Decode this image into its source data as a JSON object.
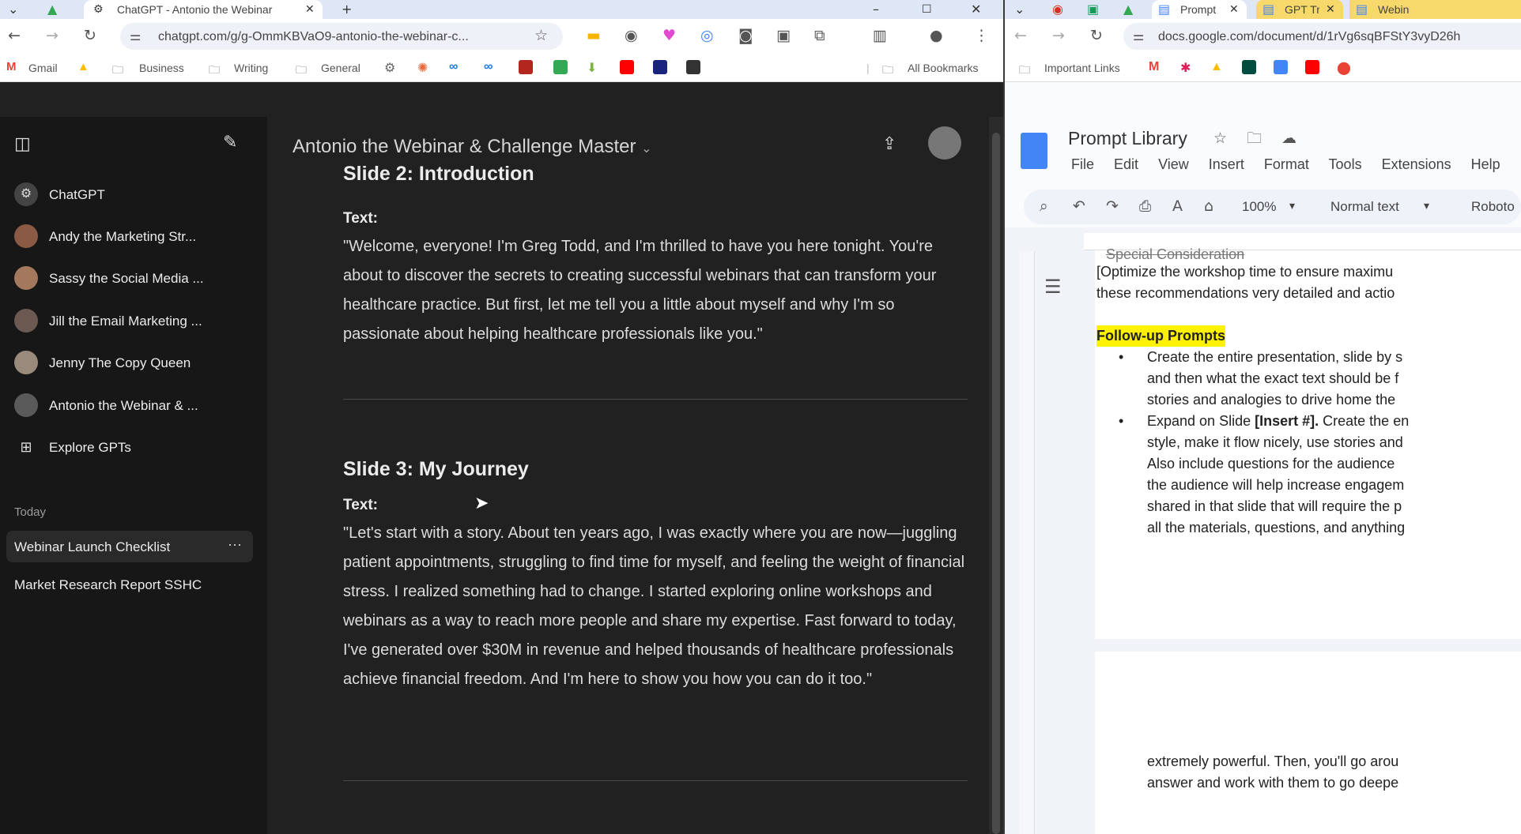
{
  "left_browser": {
    "tab_title": "ChatGPT - Antonio the Webinar",
    "url": "chatgpt.com/g/g-OmmKBVaO9-antonio-the-webinar-c...",
    "bookmarks": [
      "Gmail",
      "Business",
      "Writing",
      "General",
      "All Bookmarks"
    ]
  },
  "chatgpt": {
    "gpts": [
      "ChatGPT",
      "Andy the Marketing Str...",
      "Sassy the Social Media ...",
      "Jill the Email Marketing ...",
      "Jenny The Copy Queen",
      "Antonio the Webinar & ...",
      "Explore GPTs"
    ],
    "section_today": "Today",
    "history": [
      "Webinar Launch Checklist",
      "Market Research Report SSHC"
    ],
    "header_title": "Antonio the Webinar & Challenge Master",
    "slide2_heading": "Slide 2: Introduction",
    "slide2_label": "Text:",
    "slide2_text": "\"Welcome, everyone! I'm Greg Todd, and I'm thrilled to have you here tonight. You're about to discover the secrets to creating successful webinars that can transform your healthcare practice. But first, let me tell you a little about myself and why I'm so passionate about helping healthcare professionals like you.\"",
    "slide3_heading": "Slide 3: My Journey",
    "slide3_label": "Text:",
    "slide3_text": "\"Let's start with a story. About ten years ago, I was exactly where you are now—juggling patient appointments, struggling to find time for myself, and feeling the weight of financial stress. I realized something had to change. I started exploring online workshops and webinars as a way to reach more people and share my expertise. Fast forward to today, I've generated over $30M in revenue and helped thousands of healthcare professionals achieve financial freedom. And I'm here to show you how you can do it too.\""
  },
  "right_browser": {
    "tabs": [
      "Prompt",
      "GPT Tr",
      "Webin"
    ],
    "url": "docs.google.com/document/d/1rVg6sqBFStY3vyD26h",
    "bookmarks": [
      "Important Links"
    ]
  },
  "docs": {
    "title": "Prompt Library",
    "menu": [
      "File",
      "Edit",
      "View",
      "Insert",
      "Format",
      "Tools",
      "Extensions",
      "Help"
    ],
    "zoom": "100%",
    "style": "Normal text",
    "font": "Roboto",
    "lines": {
      "l0": "Special Consideration",
      "l1": "[Optimize the workshop time to ensure maximu",
      "l2": "these recommendations very detailed and actio",
      "heading": "Follow-up Prompts",
      "b1a": "Create the entire presentation, slide by s",
      "b1b": "and then what the exact text should be f",
      "b1c": "stories and analogies to drive home the",
      "b2a_pre": "Expand on Slide ",
      "b2a_bold": "[Insert #].",
      "b2a_post": " Create the en",
      "b2b": "style, make it flow nicely, use stories and",
      "b2c": "Also include questions for the audience",
      "b2d": "the audience will help increase engagem",
      "b2e": "shared in that slide that will require the p",
      "b2f": "all the materials, questions, and anything",
      "p2a": "extremely powerful. Then, you'll go arou",
      "p2b": "answer and work with them to go deepe"
    }
  }
}
